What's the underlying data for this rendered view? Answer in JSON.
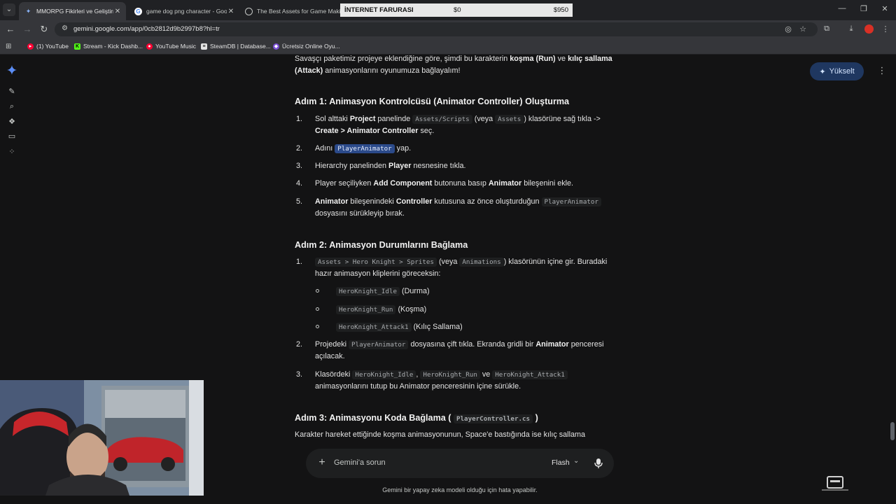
{
  "browser": {
    "tabs": [
      {
        "title": "MMORPG Fikirleri ve Geliştirme",
        "active": true
      },
      {
        "title": "game dog png character - Goo",
        "active": false
      },
      {
        "title": "The Best Assets for Game Maki",
        "active": false
      }
    ],
    "overlay": {
      "label": "İNTERNET FARURASI",
      "min": "$0",
      "max": "$950"
    },
    "url": "gemini.google.com/app/0cb2812d9b2997b8?hl=tr",
    "bookmarks": [
      "(1) YouTube",
      "Stream - Kick Dashb...",
      "YouTube Music",
      "SteamDB | Database...",
      "Ücretsiz Online Oyu..."
    ]
  },
  "app": {
    "upgrade_label": "Yükselt",
    "prompt_placeholder": "Gemini'a sorun",
    "model_label": "Flash",
    "disclaimer": "Gemini bir yapay zeka modeli olduğu için hata yapabilir."
  },
  "article": {
    "intro": {
      "t1": "Savaşçı paketimiz projeye eklendiğine göre, şimdi bu karakterin ",
      "b1": "koşma (Run)",
      "t2": " ve ",
      "b2": "kılıç sallama",
      "b3": "(Attack)",
      "t3": " animasyonlarını oyunumuza bağlayalım!"
    },
    "step1": {
      "heading": "Adım 1: Animasyon Kontrolcüsü (Animator Controller) Oluşturma",
      "items": [
        {
          "num": "1.",
          "t1": "Sol alttaki ",
          "b1": "Project",
          "t2": " panelinde ",
          "c1": "Assets/Scripts",
          "t3": " (veya ",
          "c2": "Assets",
          "t4": ") klasörüne sağ tıkla ->",
          "b2": "Create > Animator Controller",
          "t5": " seç."
        },
        {
          "num": "2.",
          "t1": "Adını ",
          "c1": "PlayerAnimator",
          "t2": " yap."
        },
        {
          "num": "3.",
          "t1": "Hierarchy panelinden ",
          "b1": "Player",
          "t2": " nesnesine tıkla."
        },
        {
          "num": "4.",
          "t1": "Player seçiliyken ",
          "b1": "Add Component",
          "t2": " butonuna basıp ",
          "b2": "Animator",
          "t3": " bileşenini ekle."
        },
        {
          "num": "5.",
          "b1": "Animator",
          "t1": " bileşenindeki ",
          "b2": "Controller",
          "t2": " kutusuna az önce oluşturduğun ",
          "c1": "PlayerAnimator",
          "t3": "dosyasını sürükleyip bırak."
        }
      ]
    },
    "step2": {
      "heading": "Adım 2: Animasyon Durumlarını Bağlama",
      "items": [
        {
          "num": "1.",
          "c1": "Assets > Hero Knight > Sprites",
          "t1": " (veya ",
          "c2": "Animations",
          "t2": ") klasörünün içine gir. Buradaki hazır animasyon kliplerini göreceksin:"
        },
        {
          "num": "2.",
          "t1": "Projedeki ",
          "c1": "PlayerAnimator",
          "t2": " dosyasına çift tıkla. Ekranda gridli bir ",
          "b1": "Animator",
          "t3": " penceresi açılacak."
        },
        {
          "num": "3.",
          "t1": "Klasördeki ",
          "c1": "HeroKnight_Idle",
          "t2": ", ",
          "c2": "HeroKnight_Run",
          "t3": " ve ",
          "c3": "HeroKnight_Attack1",
          "t4": "animasyonlarını tutup bu Animator penceresinin içine sürükle."
        }
      ],
      "clips": [
        {
          "code": "HeroKnight_Idle",
          "label": " (Durma)"
        },
        {
          "code": "HeroKnight_Run",
          "label": " (Koşma)"
        },
        {
          "code": "HeroKnight_Attack1",
          "label": " (Kılıç Sallama)"
        }
      ]
    },
    "step3": {
      "heading_prefix": "Adım 3: Animasyonu Koda Bağlama ( ",
      "heading_code": "PlayerController.cs",
      "heading_suffix": " )",
      "text": "Karakter hareket ettiğinde koşma animasyonunun, Space'e bastığında ise kılıç sallama"
    }
  }
}
